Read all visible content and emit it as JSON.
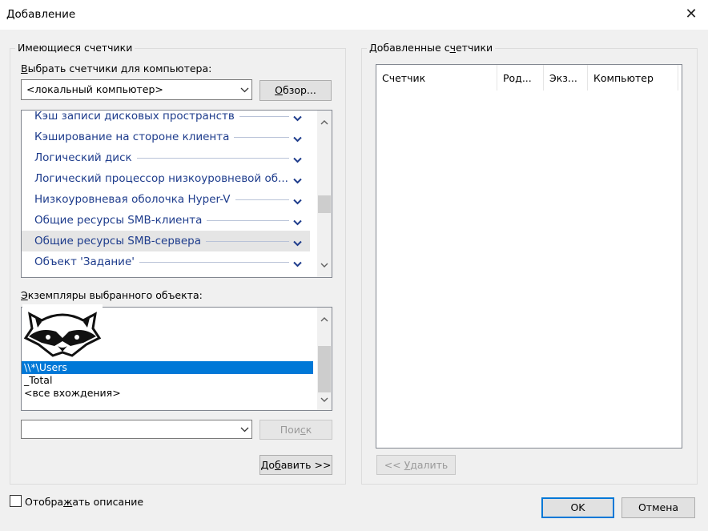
{
  "window": {
    "title": "Добавление",
    "close_glyph": "✕"
  },
  "available": {
    "group_label": "Имеющиеся счетчики",
    "select_label": "Выбрать счетчики для компьютера:",
    "computer_value": "<локальный компьютер>",
    "browse_label": "Обзор...",
    "objects": [
      {
        "name": "Кэш записи дисковых пространств",
        "selected": false
      },
      {
        "name": "Кэширование на стороне клиента",
        "selected": false
      },
      {
        "name": "Логический диск",
        "selected": false
      },
      {
        "name": "Логический процессор низкоуровневой об...",
        "selected": false
      },
      {
        "name": "Низкоуровневая оболочка Hyper-V",
        "selected": false
      },
      {
        "name": "Общие ресурсы SMB-клиента",
        "selected": false
      },
      {
        "name": "Общие ресурсы SMB-сервера",
        "selected": true
      },
      {
        "name": "Объект 'Задание'",
        "selected": false
      }
    ],
    "instances_label": "Экземпляры выбранного объекта:",
    "instances": [
      {
        "name": "\\\\*\\Users",
        "selected": true
      },
      {
        "name": "_Total",
        "selected": false
      },
      {
        "name": "<все вхождения>",
        "selected": false
      }
    ],
    "search_value": "",
    "search_label": "Поиск",
    "add_label": "Добавить >>"
  },
  "added": {
    "group_label": "Добавленные счетчики",
    "columns": [
      "Счетчик",
      "Род...",
      "Экз...",
      "Компьютер"
    ],
    "remove_label": "<< Удалить"
  },
  "footer": {
    "show_description_label": "Отображать описание",
    "ok_label": "OK",
    "cancel_label": "Отмена"
  },
  "overlay": {
    "logo": "raccoon-logo"
  },
  "colors": {
    "accent": "#0078d7",
    "object_text": "#1e3c8c"
  }
}
